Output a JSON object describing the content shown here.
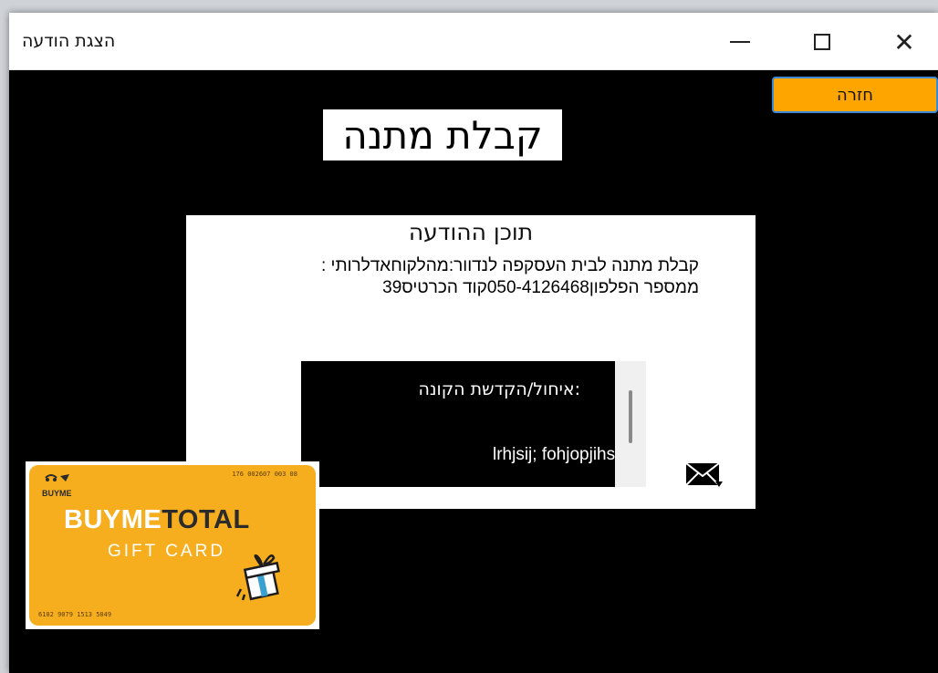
{
  "window": {
    "title": "הצגת הודעה"
  },
  "controls": {
    "minimize": "minimize",
    "maximize": "maximize",
    "close": "✕"
  },
  "toolbar": {
    "back_label": "חזרה"
  },
  "page": {
    "title": "קבלת מתנה"
  },
  "message": {
    "heading": "תוכן ההודעה",
    "line1": "קבלת מתנה לבית העסקפה לנדוור:מהלקוחאדלרותי :",
    "line2": "ממספר הפלפון050-4126468קוד הכרטיס39"
  },
  "blessing": {
    "label": ":איחול/הקדשת הקונה",
    "text": "lrhjsij; fohjopjihs"
  },
  "card": {
    "brand_light": "BUYME",
    "brand_dark": "TOTAL",
    "sub": "GIFT CARD",
    "number_top": "176 002607 003 08",
    "number_bottom": "6102 9079 1513 5049",
    "logo_text": "BUYME"
  },
  "colors": {
    "window_bg": "#000000",
    "accent_button": "#ffa500",
    "card_bg": "#f6ae1f"
  },
  "icons": {
    "minimize": "minimize-icon",
    "maximize": "maximize-icon",
    "close": "close-icon",
    "mail": "mail-icon",
    "gift": "gift-icon"
  }
}
